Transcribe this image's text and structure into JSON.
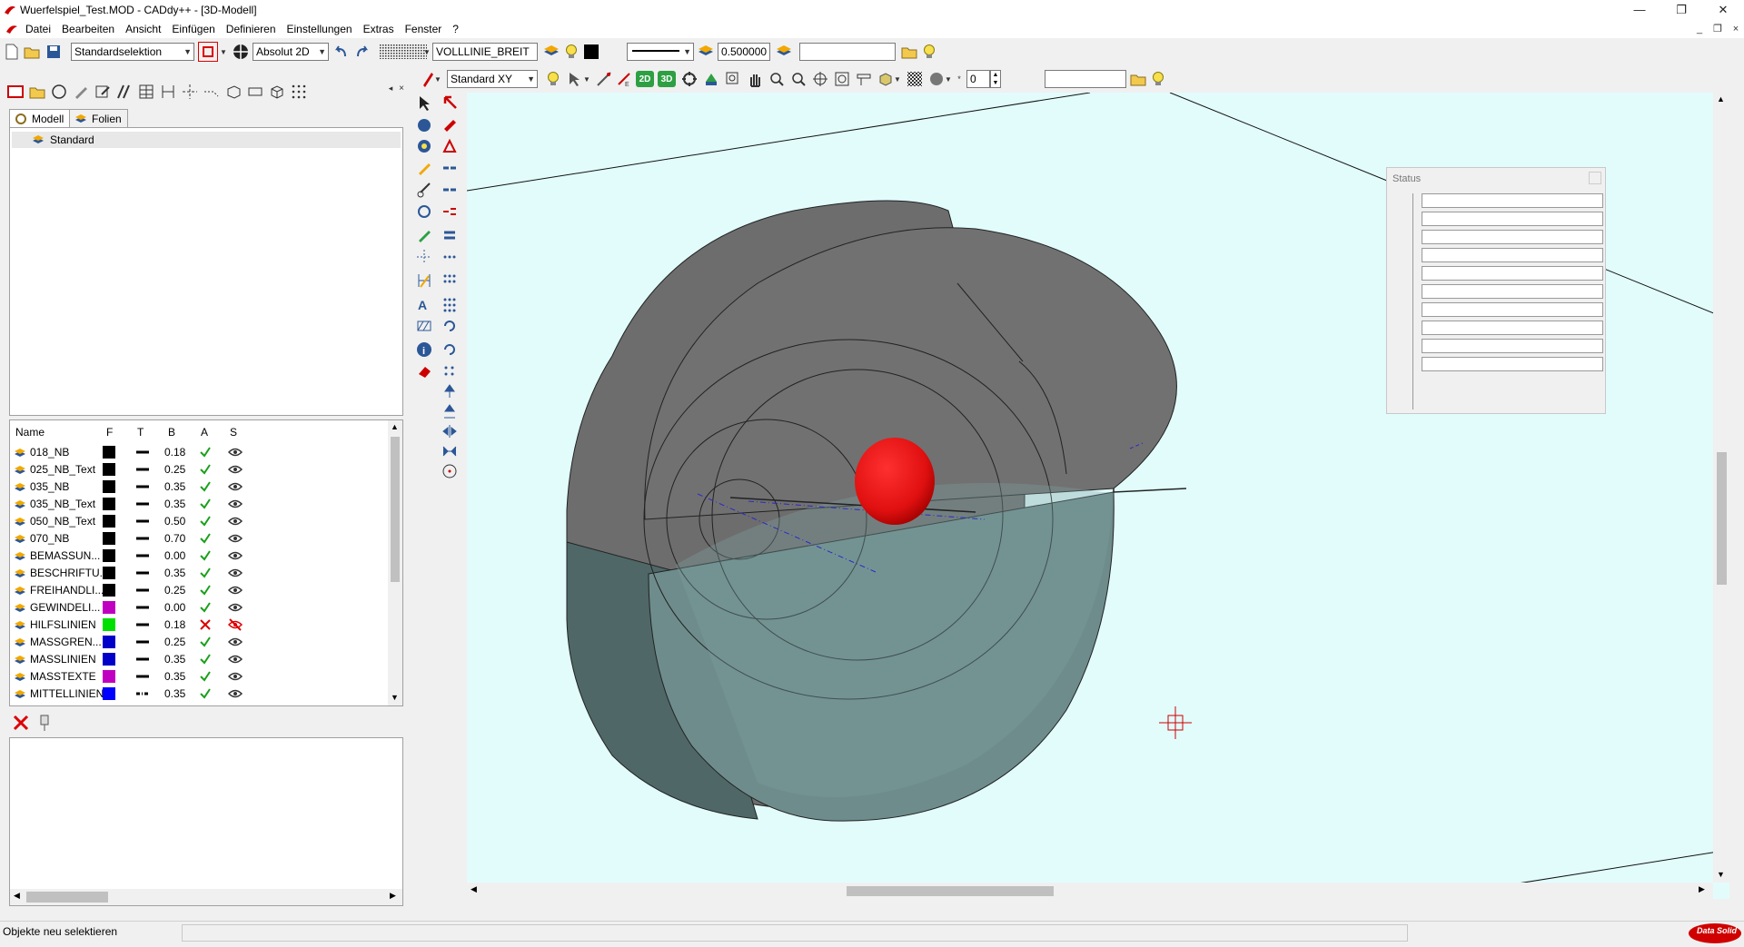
{
  "window": {
    "title": "Wuerfelspiel_Test.MOD  -  CADdy++ - [3D-Modell]",
    "minimize": "—",
    "restore": "❐",
    "close": "✕",
    "mdi_min": "_",
    "mdi_restore": "❐",
    "mdi_close": "×"
  },
  "menu": [
    "Datei",
    "Bearbeiten",
    "Ansicht",
    "Einfügen",
    "Definieren",
    "Einstellungen",
    "Extras",
    "Fenster",
    "?"
  ],
  "toolbar1": {
    "selection_mode": "Standardselektion",
    "coord_mode": "Absolut 2D",
    "linetype": "VOLLLINIE_BREIT",
    "line_width": "0.500000",
    "search_value": ""
  },
  "toolbar2": {
    "view": "Standard XY",
    "btn_2d": "2D",
    "btn_3d": "3D",
    "spin_value": "0",
    "search_value": ""
  },
  "tabs": {
    "model": "Modell",
    "layers": "Folien"
  },
  "tree": {
    "root": "Standard"
  },
  "layer_table": {
    "headers": {
      "name": "Name",
      "f": "F",
      "t": "T",
      "b": "B",
      "a": "A",
      "s": "S"
    },
    "rows": [
      {
        "name": "018_NB",
        "color": "#000000",
        "style": "solid",
        "width": "0.18",
        "active": true,
        "visible": true
      },
      {
        "name": "025_NB_Text",
        "color": "#000000",
        "style": "solid",
        "width": "0.25",
        "active": true,
        "visible": true
      },
      {
        "name": "035_NB",
        "color": "#000000",
        "style": "solid",
        "width": "0.35",
        "active": true,
        "visible": true
      },
      {
        "name": "035_NB_Text",
        "color": "#000000",
        "style": "solid",
        "width": "0.35",
        "active": true,
        "visible": true
      },
      {
        "name": "050_NB_Text",
        "color": "#000000",
        "style": "solid",
        "width": "0.50",
        "active": true,
        "visible": true
      },
      {
        "name": "070_NB",
        "color": "#000000",
        "style": "solid",
        "width": "0.70",
        "active": true,
        "visible": true
      },
      {
        "name": "BEMASSUN...",
        "color": "#000000",
        "style": "solid",
        "width": "0.00",
        "active": true,
        "visible": true
      },
      {
        "name": "BESCHRIFTU...",
        "color": "#000000",
        "style": "solid",
        "width": "0.35",
        "active": true,
        "visible": true
      },
      {
        "name": "FREIHANDLI...",
        "color": "#000000",
        "style": "solid",
        "width": "0.25",
        "active": true,
        "visible": true
      },
      {
        "name": "GEWINDELI...",
        "color": "#c000c0",
        "style": "solid",
        "width": "0.00",
        "active": true,
        "visible": true
      },
      {
        "name": "HILFSLINIEN",
        "color": "#00e000",
        "style": "solid",
        "width": "0.18",
        "active": false,
        "visible": false
      },
      {
        "name": "MASSGREN...",
        "color": "#0000c8",
        "style": "solid",
        "width": "0.25",
        "active": true,
        "visible": true
      },
      {
        "name": "MASSLINIEN",
        "color": "#0000c8",
        "style": "solid",
        "width": "0.35",
        "active": true,
        "visible": true
      },
      {
        "name": "MASSTEXTE",
        "color": "#c000c0",
        "style": "solid",
        "width": "0.35",
        "active": true,
        "visible": true
      },
      {
        "name": "MITTELLINIEN",
        "color": "#0000ff",
        "style": "dashdot",
        "width": "0.35",
        "active": true,
        "visible": true
      }
    ]
  },
  "status_window": {
    "title": "Status",
    "row_count": 10
  },
  "statusbar": {
    "message": "Objekte neu selektieren",
    "field2": "",
    "brand": "Data Solid"
  },
  "colors": {
    "viewport_bg": "#e2fcfc",
    "solid_top": "#6d6d6d",
    "solid_bottom": "#6e8c8c",
    "sphere": "#e01010",
    "accent_red": "#d00000"
  }
}
